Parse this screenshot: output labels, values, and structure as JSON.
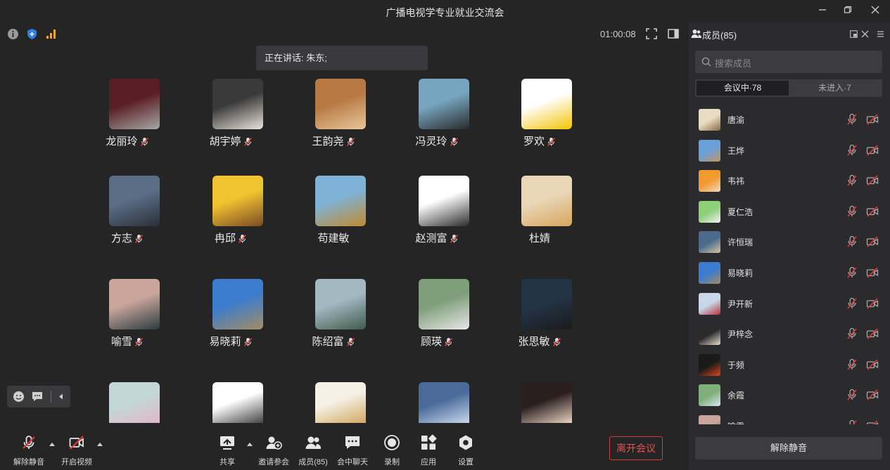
{
  "window": {
    "title": "广播电视学专业就业交流会"
  },
  "status": {
    "timer": "01:00:08",
    "speaking": "正在讲话: 朱东;"
  },
  "participants": [
    {
      "name": "龙丽玲",
      "muted": true,
      "colors": [
        "#5a1f24",
        "#a8a8a8"
      ]
    },
    {
      "name": "胡宇婷",
      "muted": true,
      "colors": [
        "#3a3a3a",
        "#e9e4dc"
      ]
    },
    {
      "name": "王韵尧",
      "muted": true,
      "colors": [
        "#b87943",
        "#e8c79b"
      ]
    },
    {
      "name": "冯灵玲",
      "muted": true,
      "colors": [
        "#75a5bf",
        "#2b2b2b"
      ]
    },
    {
      "name": "罗欢",
      "muted": true,
      "colors": [
        "#ffffff",
        "#f3c400"
      ]
    },
    {
      "name": "方志",
      "muted": true,
      "colors": [
        "#5b6e86",
        "#2a2f38"
      ]
    },
    {
      "name": "冉邱",
      "muted": true,
      "colors": [
        "#f0c330",
        "#7b4a25"
      ]
    },
    {
      "name": "苟建敏",
      "muted": false,
      "colors": [
        "#7fb2d6",
        "#c08a2e"
      ]
    },
    {
      "name": "赵测富",
      "muted": true,
      "colors": [
        "#ffffff",
        "#2b2b2b"
      ]
    },
    {
      "name": "杜婧",
      "muted": false,
      "colors": [
        "#e9d7b8",
        "#d8a55c"
      ]
    },
    {
      "name": "喻雪",
      "muted": true,
      "colors": [
        "#c9a59c",
        "#2a3b3e"
      ]
    },
    {
      "name": "易晓莉",
      "muted": true,
      "colors": [
        "#3b7ccf",
        "#a48c63"
      ]
    },
    {
      "name": "陈绍富",
      "muted": true,
      "colors": [
        "#a4b8c2",
        "#3f5b4a"
      ]
    },
    {
      "name": "顾瑛",
      "muted": true,
      "colors": [
        "#7f9e7a",
        "#e8e8e8"
      ]
    },
    {
      "name": "张思敏",
      "muted": true,
      "colors": [
        "#243447",
        "#1b1b1b"
      ]
    },
    {
      "name": "",
      "muted": false,
      "colors": [
        "#c3d8d6",
        "#e0b8c8"
      ]
    },
    {
      "name": "",
      "muted": false,
      "colors": [
        "#ffffff",
        "#444444"
      ]
    },
    {
      "name": "",
      "muted": false,
      "colors": [
        "#f4f0e4",
        "#d4a862"
      ]
    },
    {
      "name": "",
      "muted": false,
      "colors": [
        "#4a6a9a",
        "#c8d8ec"
      ]
    },
    {
      "name": "",
      "muted": false,
      "colors": [
        "#2a1f1f",
        "#e8d2c2"
      ]
    }
  ],
  "toolbar": {
    "unmute": "解除静音",
    "video": "开启视频",
    "share": "共享",
    "invite": "邀请参会",
    "members": "成员(85)",
    "chat": "会中聊天",
    "record": "录制",
    "apps": "应用",
    "settings": "设置",
    "leave": "离开会议"
  },
  "panel": {
    "title": "成员(85)",
    "search_placeholder": "搜索成员",
    "tab_in_meeting": "会议中·78",
    "tab_not_joined": "未进入·7",
    "unmute_all": "解除静音",
    "members": [
      {
        "name": "唐渝",
        "colors": [
          "#e8dcc3",
          "#8a6a44"
        ]
      },
      {
        "name": "王烨",
        "colors": [
          "#6aa0d8",
          "#c2955b"
        ]
      },
      {
        "name": "韦祎",
        "colors": [
          "#f19a2e",
          "#f5d9c2"
        ]
      },
      {
        "name": "夏仁浩",
        "colors": [
          "#8ed07a",
          "#f2f2f2"
        ]
      },
      {
        "name": "许恒瑞",
        "colors": [
          "#4b6a8c",
          "#d8c4a2"
        ]
      },
      {
        "name": "易晓莉",
        "colors": [
          "#3b7ccf",
          "#a48c63"
        ]
      },
      {
        "name": "尹开新",
        "colors": [
          "#c8d8e8",
          "#b8323a"
        ]
      },
      {
        "name": "尹梓念",
        "colors": [
          "#2a2a2a",
          "#e8ddd2"
        ]
      },
      {
        "name": "于频",
        "colors": [
          "#1a1a1a",
          "#e0451a"
        ]
      },
      {
        "name": "余霞",
        "colors": [
          "#7fb07a",
          "#dbe6ef"
        ]
      },
      {
        "name": "喻雪",
        "colors": [
          "#c9a59c",
          "#2a3b3e"
        ]
      }
    ]
  }
}
